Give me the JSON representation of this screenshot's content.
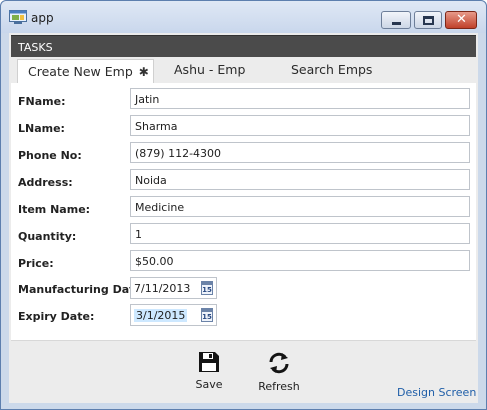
{
  "window": {
    "title": "app",
    "icon": "app-window-icon",
    "controls": [
      "minimize-icon",
      "maximize-icon",
      "close-icon"
    ]
  },
  "tasks_header": "TASKS",
  "tabs": [
    {
      "label": "Create New Emp",
      "active": true,
      "modified_icon": "✱"
    },
    {
      "label": "Ashu - Emp",
      "active": false
    },
    {
      "label": "Search Emps",
      "active": false
    }
  ],
  "form": {
    "fname": {
      "label": "FName:",
      "value": "Jatin"
    },
    "lname": {
      "label": "LName:",
      "value": "Sharma"
    },
    "phone": {
      "label": "Phone No:",
      "value": "(879) 112-4300"
    },
    "address": {
      "label": "Address:",
      "value": "Noida"
    },
    "item_name": {
      "label": "Item Name:",
      "value": "Medicine"
    },
    "quantity": {
      "label": "Quantity:",
      "value": "1"
    },
    "price": {
      "label": "Price:",
      "value": "$50.00"
    },
    "manufacturing_date": {
      "label": "Manufacturing Date:",
      "value": "7/11/2013",
      "calendar_icon_text": "15"
    },
    "expiry_date": {
      "label": "Expiry Date:",
      "value": "3/1/2015",
      "calendar_icon_text": "15"
    }
  },
  "toolbar": {
    "save_label": "Save",
    "save_icon": "floppy-disk-icon",
    "refresh_label": "Refresh",
    "refresh_icon": "refresh-icon",
    "design_link": "Design Screen"
  },
  "colors": {
    "tasks_header_bg": "#4b4b4b",
    "link": "#1f5ea8",
    "focus_highlight": "#cde8ff"
  }
}
